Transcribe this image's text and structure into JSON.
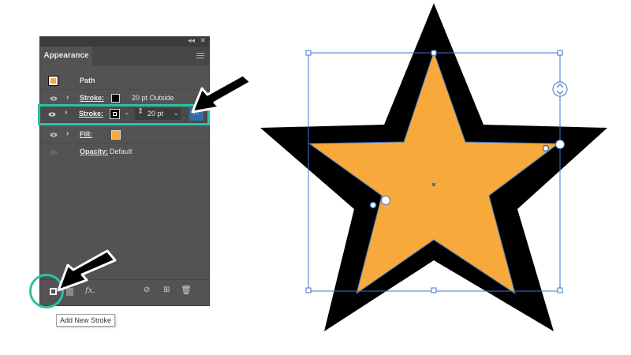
{
  "panel": {
    "tab": "Appearance",
    "object_label": "Path",
    "rows": [
      {
        "label": "Stroke:",
        "value": "20 pt  Outside",
        "color": "#000000"
      },
      {
        "label": "Stroke:",
        "value": "20 pt",
        "more": "..."
      },
      {
        "label": "Fill:",
        "color": "#f7a93b"
      },
      {
        "label": "Opacity:",
        "value": "Default"
      }
    ],
    "bottom": {
      "fx_label": "fx."
    }
  },
  "tooltip": "Add New Stroke",
  "colors": {
    "accent": "#2bc2a4",
    "panel_bg": "#535353",
    "star_fill": "#f7a93b",
    "selection": "#3f76c9"
  }
}
